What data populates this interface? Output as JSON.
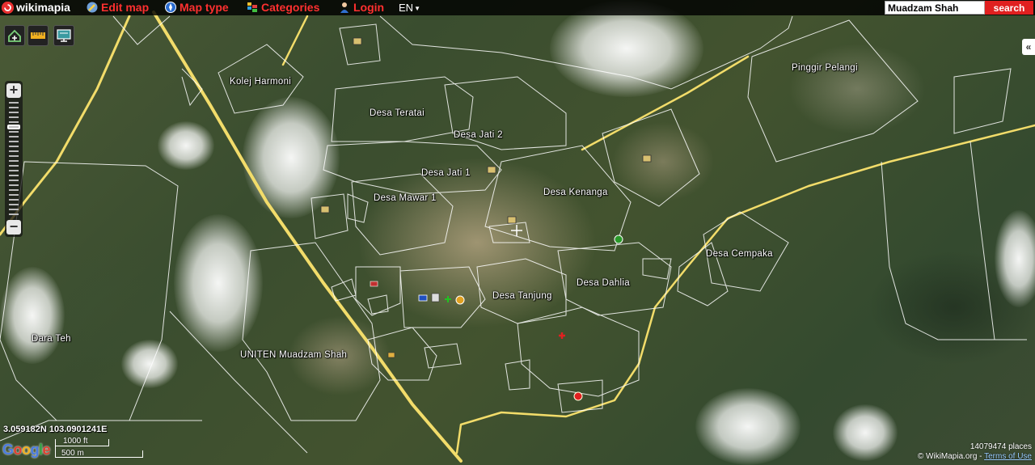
{
  "topbar": {
    "logo": "wikimapia",
    "edit_map": "Edit map",
    "map_type": "Map type",
    "categories": "Categories",
    "login": "Login",
    "language": "EN",
    "search_value": "Muadzam Shah",
    "search_button": "search"
  },
  "places": [
    {
      "name": "Kolej Harmoni"
    },
    {
      "name": "Desa Teratai"
    },
    {
      "name": "Desa Jati 2"
    },
    {
      "name": "Desa Jati 1"
    },
    {
      "name": "Desa Mawar 1"
    },
    {
      "name": "Desa Kenanga"
    },
    {
      "name": "Desa Cempaka"
    },
    {
      "name": "Desa Tanjung"
    },
    {
      "name": "Desa Dahlia"
    },
    {
      "name": "Pinggir Pelangi"
    },
    {
      "name": "Dara Teh"
    },
    {
      "name": "UNITEN Muadzam Shah"
    }
  ],
  "status": {
    "coordinates": "3.059182N 103.0901241E",
    "scale_imperial": "1000 ft",
    "scale_metric": "500 m",
    "google": "Google",
    "places_count": "14079474 places",
    "copyright": "© WikiMapia.org - ",
    "terms": "Terms of Use"
  },
  "colors": {
    "brand_red": "#e02020",
    "road_yellow": "#f2dc6a",
    "outline_white": "#ffffff"
  },
  "icons": [
    "wikimapia-logo-icon",
    "edit-map-icon",
    "map-type-compass-icon",
    "categories-icon",
    "login-user-icon",
    "home-tool-icon",
    "ruler-tool-icon",
    "monitor-tool-icon",
    "zoom-in-icon",
    "zoom-out-icon",
    "collapse-panel-icon"
  ]
}
